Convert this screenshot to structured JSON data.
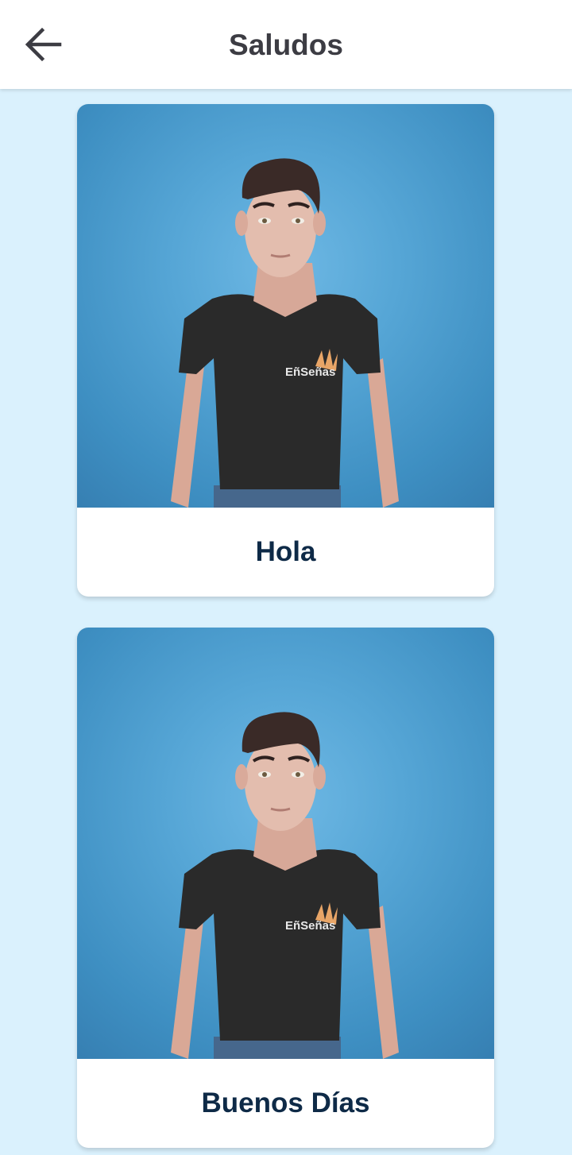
{
  "header": {
    "title": "Saludos",
    "back_icon": "arrow-left-icon"
  },
  "cards": [
    {
      "label": "Hola",
      "image": "avatar-sign-video-thumbnail",
      "shirt_logo": "EñSeñas"
    },
    {
      "label": "Buenos Días",
      "image": "avatar-sign-video-thumbnail",
      "shirt_logo": "EñSeñas"
    }
  ],
  "colors": {
    "background": "#daf1fd",
    "header_bg": "#ffffff",
    "title": "#3c3c43",
    "card_label": "#0e2a47",
    "thumbnail_bg": "#4f9fd1"
  }
}
